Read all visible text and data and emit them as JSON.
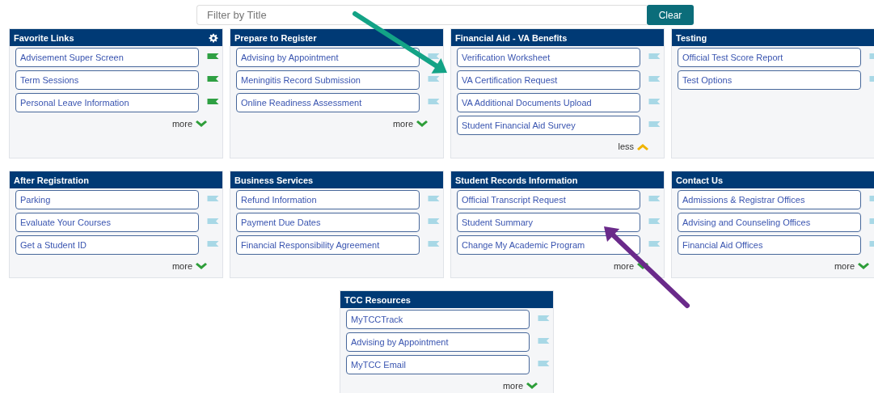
{
  "search": {
    "placeholder": "Filter by Title",
    "button": "Clear"
  },
  "cards": [
    {
      "title": "Favorite Links",
      "settings": true,
      "links": [
        {
          "label": "Advisement Super Screen",
          "favorite": true
        },
        {
          "label": "Term Sessions",
          "favorite": true
        },
        {
          "label": "Personal Leave Information",
          "favorite": true
        }
      ],
      "toggle": {
        "label": "more",
        "expanded": false
      }
    },
    {
      "title": "Prepare to Register",
      "settings": false,
      "links": [
        {
          "label": "Advising by Appointment",
          "favorite": false
        },
        {
          "label": "Meningitis Record Submission",
          "favorite": false
        },
        {
          "label": "Online Readiness Assessment",
          "favorite": false
        }
      ],
      "toggle": {
        "label": "more",
        "expanded": false
      }
    },
    {
      "title": "Financial Aid - VA Benefits",
      "settings": false,
      "links": [
        {
          "label": "Verification Worksheet",
          "favorite": false
        },
        {
          "label": "VA Certification Request",
          "favorite": false
        },
        {
          "label": "VA Additional Documents Upload",
          "favorite": false
        },
        {
          "label": "Student Financial Aid Survey",
          "favorite": false
        }
      ],
      "toggle": {
        "label": "less",
        "expanded": true
      }
    },
    {
      "title": "Testing",
      "settings": false,
      "links": [
        {
          "label": "Official Test Score Report",
          "favorite": false
        },
        {
          "label": "Test Options",
          "favorite": false
        }
      ]
    },
    {
      "title": "After Registration",
      "settings": false,
      "links": [
        {
          "label": "Parking",
          "favorite": false
        },
        {
          "label": "Evaluate Your Courses",
          "favorite": false
        },
        {
          "label": "Get a Student ID",
          "favorite": false
        }
      ],
      "toggle": {
        "label": "more",
        "expanded": false
      }
    },
    {
      "title": "Business Services",
      "settings": false,
      "links": [
        {
          "label": "Refund Information",
          "favorite": false
        },
        {
          "label": "Payment Due Dates",
          "favorite": false
        },
        {
          "label": "Financial Responsibility Agreement",
          "favorite": false
        }
      ]
    },
    {
      "title": "Student Records Information",
      "settings": false,
      "links": [
        {
          "label": "Official Transcript Request",
          "favorite": false
        },
        {
          "label": "Student Summary",
          "favorite": false
        },
        {
          "label": "Change My Academic Program",
          "favorite": false
        }
      ],
      "toggle": {
        "label": "more",
        "expanded": false
      }
    },
    {
      "title": "Contact Us",
      "settings": false,
      "links": [
        {
          "label": "Admissions & Registrar Offices",
          "favorite": false
        },
        {
          "label": "Advising and Counseling Offices",
          "favorite": false
        },
        {
          "label": "Financial Aid Offices",
          "favorite": false
        }
      ],
      "toggle": {
        "label": "more",
        "expanded": false
      }
    },
    {
      "title": "TCC Resources",
      "settings": false,
      "links": [
        {
          "label": "MyTCCTrack",
          "favorite": false
        },
        {
          "label": "Advising by Appointment",
          "favorite": false
        },
        {
          "label": "MyTCC Email",
          "favorite": false
        }
      ],
      "toggle": {
        "label": "more",
        "expanded": false
      }
    }
  ],
  "annotations": [
    {
      "kind": "arrow",
      "color": "#13a386"
    },
    {
      "kind": "arrow",
      "color": "#6a2a8a"
    }
  ]
}
